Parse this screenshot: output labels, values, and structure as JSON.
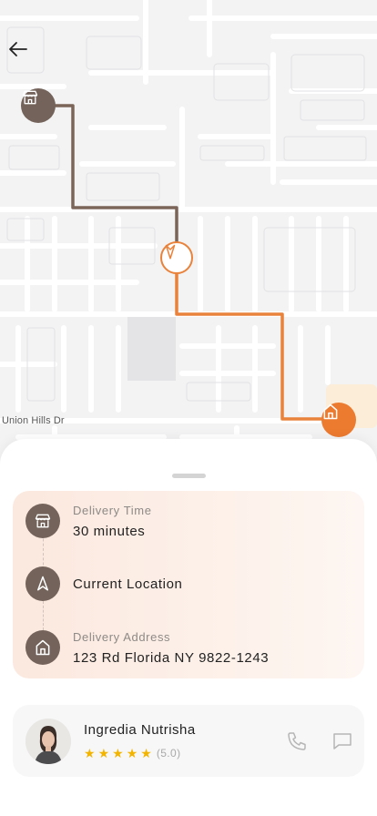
{
  "map": {
    "street_label": "Union Hills Dr",
    "colors": {
      "route_start": "#7a6558",
      "route_end": "#e9823b",
      "destination_marker": "#ec7a2f",
      "store_marker": "#73635a"
    }
  },
  "header": {
    "back_icon": "arrow-left-icon"
  },
  "delivery": {
    "time_label": "Delivery Time",
    "time_value": "30 minutes",
    "current_location": "Current Location",
    "address_label": "Delivery Address",
    "address_value": "123 Rd Florida NY 9822-1243",
    "icons": [
      "store-icon",
      "navigation-arrow-icon",
      "home-icon"
    ]
  },
  "courier": {
    "name": "Ingredia Nutrisha",
    "rating_stars": 5,
    "rating_text": "(5.0)",
    "actions": [
      "phone-icon",
      "chat-icon"
    ]
  }
}
